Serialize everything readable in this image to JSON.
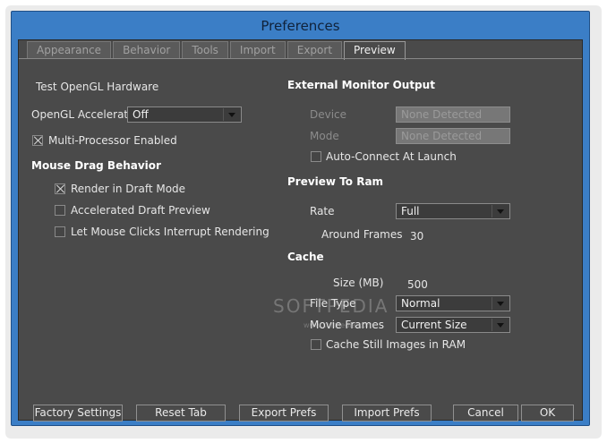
{
  "window": {
    "title": "Preferences"
  },
  "tabs": [
    {
      "label": "Appearance",
      "active": false
    },
    {
      "label": "Behavior",
      "active": false
    },
    {
      "label": "Tools",
      "active": false
    },
    {
      "label": "Import",
      "active": false
    },
    {
      "label": "Export",
      "active": false
    },
    {
      "label": "Preview",
      "active": true
    }
  ],
  "left": {
    "test_opengl": "Test OpenGL Hardware",
    "opengl_accel_label": "OpenGL Acceleration",
    "opengl_accel_value": "Off",
    "multiprocessor_label": "Multi-Processor Enabled",
    "multiprocessor_checked": true,
    "mouse_drag_heading": "Mouse Drag Behavior",
    "render_draft_label": "Render in Draft Mode",
    "render_draft_checked": true,
    "accel_draft_label": "Accelerated Draft Preview",
    "accel_draft_checked": false,
    "mouse_interrupt_label": "Let Mouse Clicks Interrupt Rendering",
    "mouse_interrupt_checked": false
  },
  "right": {
    "ext_monitor_heading": "External Monitor Output",
    "device_label": "Device",
    "device_value": "None Detected",
    "mode_label": "Mode",
    "mode_value": "None Detected",
    "auto_connect_label": "Auto-Connect At Launch",
    "auto_connect_checked": false,
    "preview_ram_heading": "Preview To Ram",
    "rate_label": "Rate",
    "rate_value": "Full",
    "around_frames_label": "Around Frames",
    "around_frames_value": "30",
    "cache_heading": "Cache",
    "size_label": "Size (MB)",
    "size_value": "500",
    "file_type_label": "File Type",
    "file_type_value": "Normal",
    "movie_frames_label": "Movie Frames",
    "movie_frames_value": "Current Size",
    "cache_still_label": "Cache Still Images in RAM",
    "cache_still_checked": false
  },
  "buttons": {
    "factory": "Factory Settings",
    "reset_tab": "Reset Tab",
    "export_prefs": "Export Prefs",
    "import_prefs": "Import Prefs",
    "cancel": "Cancel",
    "ok": "OK"
  },
  "watermark": {
    "text": "SOFTPEDIA",
    "sub": "www.softpedia.com"
  }
}
